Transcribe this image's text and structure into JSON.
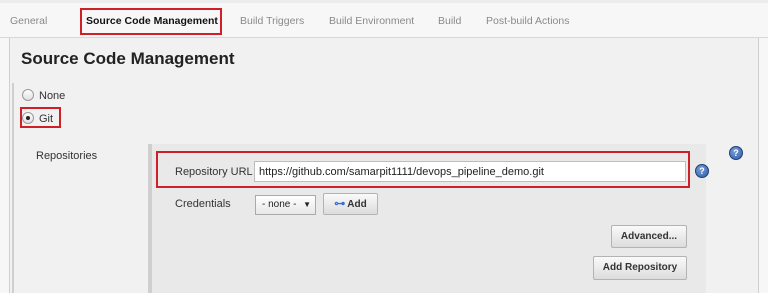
{
  "tabs": [
    "General",
    "Source Code Management",
    "Build Triggers",
    "Build Environment",
    "Build",
    "Post-build Actions"
  ],
  "section": {
    "title": "Source Code Management"
  },
  "scm_options": {
    "none_label": "None",
    "git_label": "Git",
    "selected": "Git"
  },
  "repositories": {
    "label": "Repositories",
    "url_label": "Repository URL",
    "url_value": "https://github.com/samarpit1111/devops_pipeline_demo.git",
    "credentials_label": "Credentials",
    "credentials_value": "- none -",
    "add_label": "Add",
    "advanced_label": "Advanced...",
    "add_repository_label": "Add Repository"
  },
  "icons": {
    "help": "help-icon",
    "key": "key-icon",
    "dropdown": "chevron-down-icon"
  },
  "colors": {
    "highlight": "#cf2027",
    "help_icon": "#2d5aa8"
  }
}
